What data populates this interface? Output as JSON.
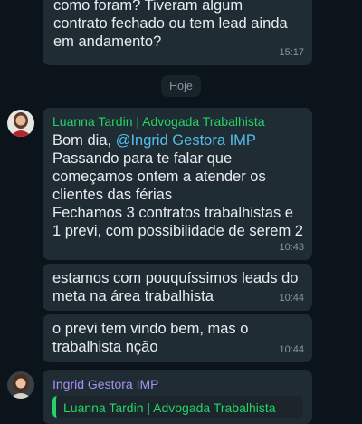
{
  "messages": [
    {
      "text": "como foram? Tiveram algum\ncontrato fechado ou tem lead ainda\nem andamento?",
      "time": "15:17"
    }
  ],
  "date_separator": "Hoje",
  "message_group_1": {
    "sender": "Luanna Tardin | Advogada Trabalhista",
    "sender_color": "#25d366",
    "first": {
      "greeting": "Bom dia, ",
      "mention": "@Ingrid Gestora IMP",
      "body": "Passando para te falar que\ncomeçamos ontem a atender os\nclientes das férias\nFechamos 3 contratos trabalhistas e\n1 previ, com possibilidade de serem 2",
      "time": "10:43"
    },
    "second": {
      "text": "estamos com pouquíssimos leads do\nmeta na área trabalhista",
      "time": "10:44"
    },
    "third": {
      "text": "o previ tem vindo bem, mas o\ntrabalhista nção",
      "time": "10:44"
    }
  },
  "message_group_2": {
    "sender": "Ingrid Gestora IMP",
    "sender_color": "#a791f4",
    "quoted_sender": "Luanna Tardin | Advogada Trabalhista"
  }
}
